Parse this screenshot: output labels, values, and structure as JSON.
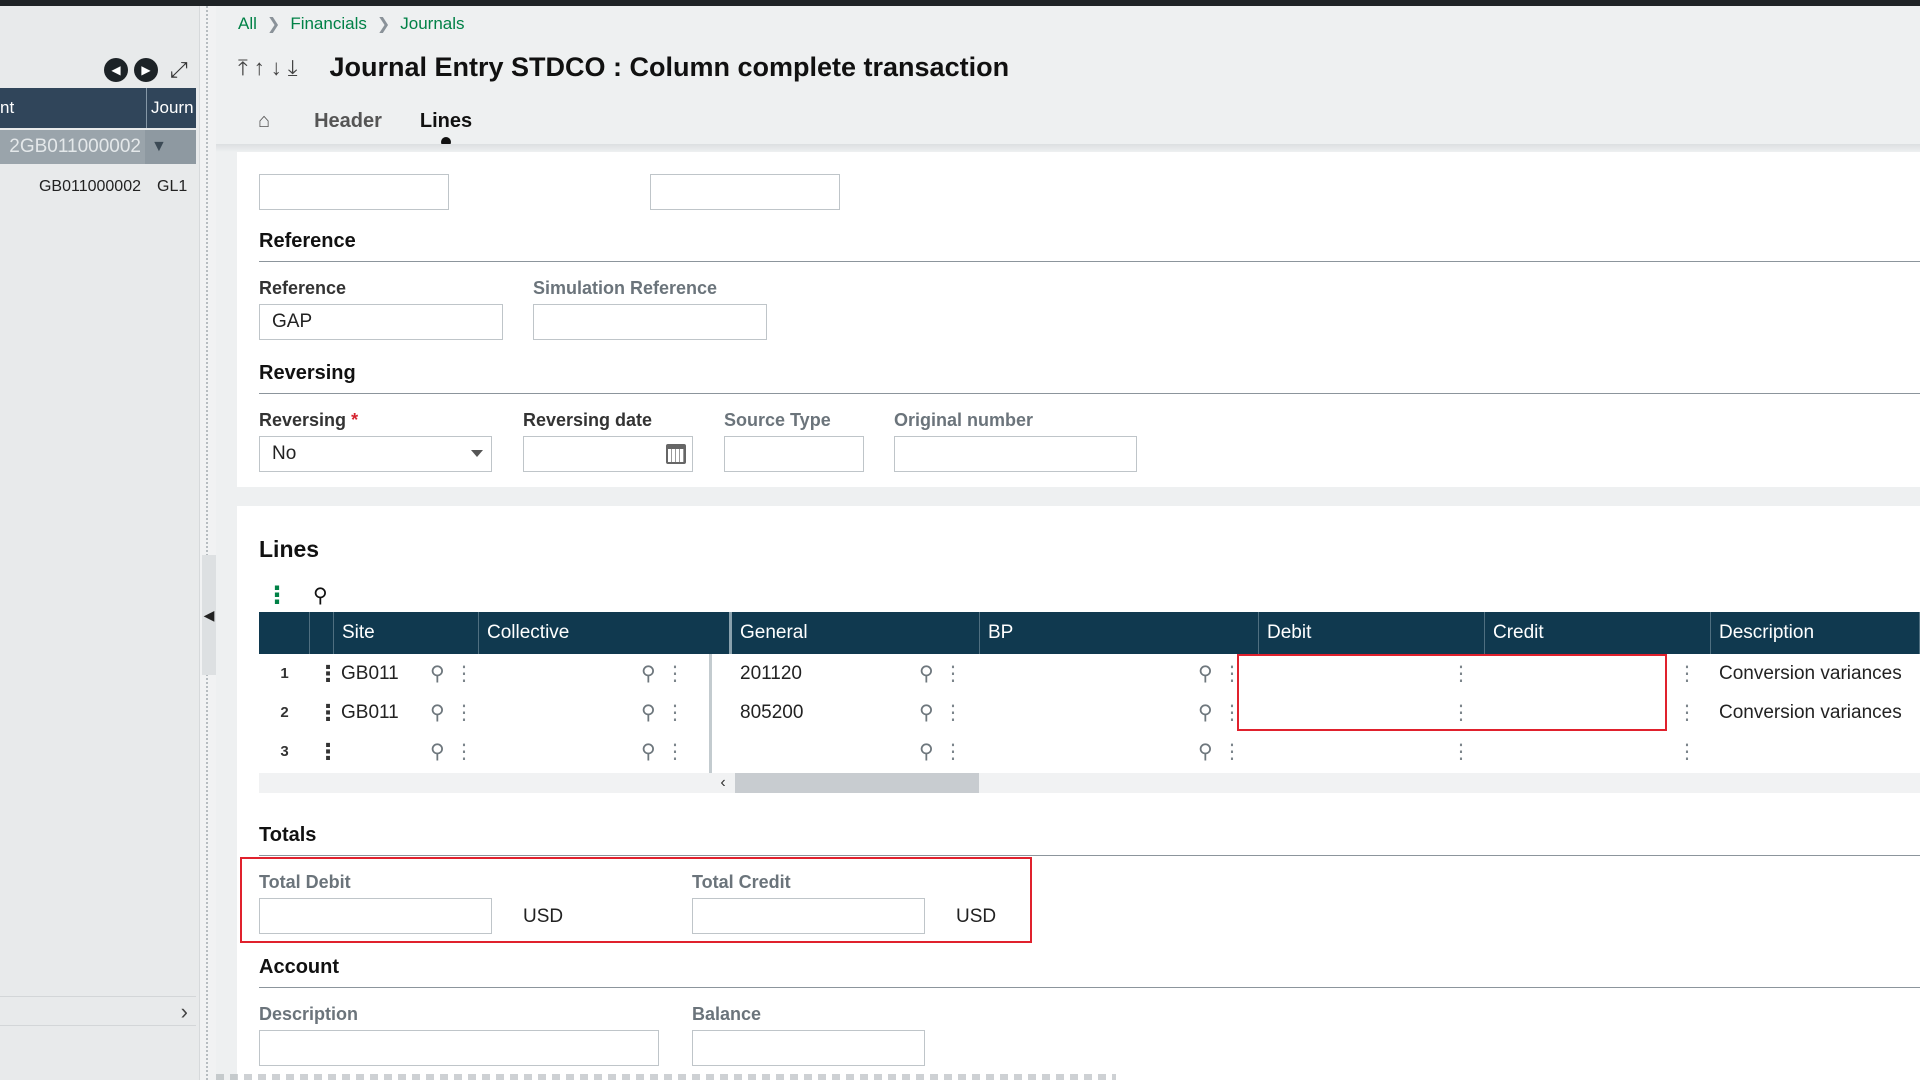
{
  "left_panel": {
    "header_col1": "nt",
    "header_col2": "Journ",
    "filter_value": "2GB011000002",
    "row_col1": "GB011000002",
    "row_col2": "GL1"
  },
  "breadcrumb": [
    "All",
    "Financials",
    "Journals"
  ],
  "page_title": "Journal Entry STDCO : Column complete transaction",
  "tabs": {
    "header": "Header",
    "lines": "Lines"
  },
  "reference_section": {
    "title": "Reference",
    "reference_label": "Reference",
    "reference_value": "GAP",
    "simulation_reference_label": "Simulation Reference",
    "simulation_reference_value": ""
  },
  "reversing_section": {
    "title": "Reversing",
    "reversing_label": "Reversing",
    "required_mark": "*",
    "reversing_value": "No",
    "reversing_date_label": "Reversing date",
    "reversing_date_value": "",
    "source_type_label": "Source Type",
    "source_type_value": "",
    "original_number_label": "Original number",
    "original_number_value": ""
  },
  "lines_section": {
    "title": "Lines",
    "columns": [
      "Site",
      "Collective",
      "General",
      "BP",
      "Debit",
      "Credit",
      "Description"
    ],
    "rows": [
      {
        "num": "1",
        "site": "GB011",
        "collective": "",
        "general": "201120",
        "bp": "",
        "debit": "",
        "credit": "",
        "description": "Conversion variances"
      },
      {
        "num": "2",
        "site": "GB011",
        "collective": "",
        "general": "805200",
        "bp": "",
        "debit": "",
        "credit": "",
        "description": "Conversion variances"
      },
      {
        "num": "3",
        "site": "",
        "collective": "",
        "general": "",
        "bp": "",
        "debit": "",
        "credit": "",
        "description": ""
      }
    ]
  },
  "totals_section": {
    "title": "Totals",
    "total_debit_label": "Total Debit",
    "total_debit_value": "",
    "total_debit_currency": "USD",
    "total_credit_label": "Total Credit",
    "total_credit_value": "",
    "total_credit_currency": "USD"
  },
  "account_section": {
    "title": "Account",
    "description_label": "Description",
    "description_value": "",
    "balance_label": "Balance",
    "balance_value": ""
  },
  "colors": {
    "accent_green": "#008146",
    "grid_header": "#10394f",
    "highlight_red": "#e0212d"
  }
}
